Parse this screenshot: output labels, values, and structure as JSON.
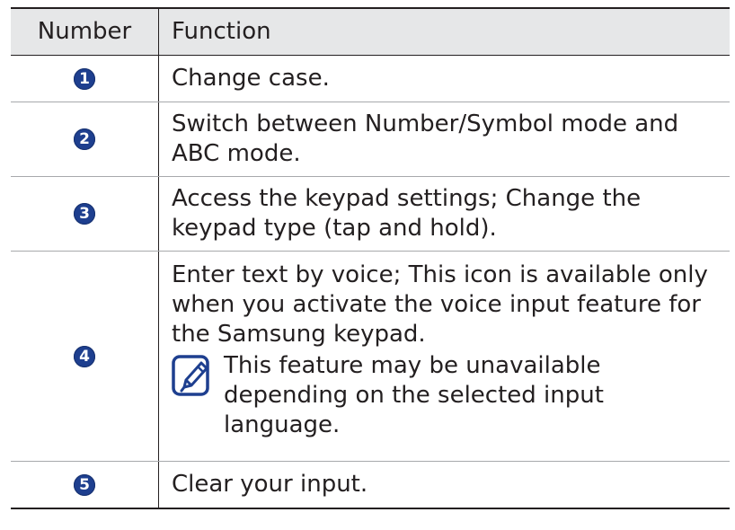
{
  "table": {
    "header": {
      "number": "Number",
      "function": "Function"
    },
    "rows": [
      {
        "number": "1",
        "text": "Change case."
      },
      {
        "number": "2",
        "line1": "Switch between Number/Symbol mode and",
        "line2": "ABC mode."
      },
      {
        "number": "3",
        "line1": "Access the keypad settings; Change the",
        "line2": "keypad type (tap and hold)."
      },
      {
        "number": "4",
        "line1": "Enter text by voice; This icon is available only",
        "line2": "when you activate the voice input feature for",
        "line3": "the Samsung keypad.",
        "note": {
          "icon": "note-pencil-icon",
          "line1": "This feature may be unavailable",
          "line2": "depending on the selected input",
          "line3": "language."
        }
      },
      {
        "number": "5",
        "text": "Clear your input."
      }
    ]
  },
  "colors": {
    "badge": "#1e3f8f",
    "header_bg": "#e6e7e8",
    "rule": "#231f20",
    "divider": "#a7a9ac"
  }
}
